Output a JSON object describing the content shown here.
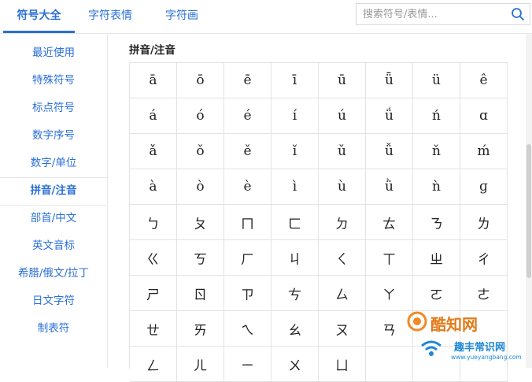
{
  "tabs": [
    {
      "label": "符号大全",
      "active": true
    },
    {
      "label": "字符表情",
      "active": false
    },
    {
      "label": "字符画",
      "active": false
    }
  ],
  "search": {
    "placeholder": "搜索符号/表情..."
  },
  "sidebar": {
    "items": [
      {
        "label": "最近使用",
        "active": false
      },
      {
        "label": "特殊符号",
        "active": false
      },
      {
        "label": "标点符号",
        "active": false
      },
      {
        "label": "数字序号",
        "active": false
      },
      {
        "label": "数字/单位",
        "active": false
      },
      {
        "label": "拼音/注音",
        "active": true
      },
      {
        "label": "部首/中文",
        "active": false
      },
      {
        "label": "英文音标",
        "active": false
      },
      {
        "label": "希腊/俄文/拉丁",
        "active": false
      },
      {
        "label": "日文字符",
        "active": false
      },
      {
        "label": "制表符",
        "active": false
      }
    ]
  },
  "main": {
    "section_title": "拼音/注音",
    "rows": [
      [
        "ā",
        "ō",
        "ē",
        "ī",
        "ū",
        "ǖ",
        "ü",
        "ê"
      ],
      [
        "á",
        "ó",
        "é",
        "í",
        "ú",
        "ǘ",
        "ń",
        "ɑ"
      ],
      [
        "ǎ",
        "ǒ",
        "ě",
        "ǐ",
        "ǔ",
        "ǚ",
        "ň",
        "ḿ"
      ],
      [
        "à",
        "ò",
        "è",
        "ì",
        "ù",
        "ǜ",
        "ǹ",
        "ɡ"
      ],
      [
        "ㄅ",
        "ㄆ",
        "ㄇ",
        "ㄈ",
        "ㄉ",
        "ㄊ",
        "ㄋ",
        "ㄌ"
      ],
      [
        "ㄍ",
        "ㄎ",
        "ㄏ",
        "ㄐ",
        "ㄑ",
        "ㄒ",
        "ㄓ",
        "ㄔ"
      ],
      [
        "ㄕ",
        "ㄖ",
        "ㄗ",
        "ㄘ",
        "ㄙ",
        "ㄚ",
        "ㄛ",
        "ㄜ"
      ],
      [
        "ㄝ",
        "ㄞ",
        "ㄟ",
        "ㄠ",
        "ㄡ",
        "ㄢ",
        "",
        ""
      ],
      [
        "ㄥ",
        "ㄦ",
        "ㄧ",
        "ㄨ",
        "ㄩ",
        "",
        "",
        ""
      ]
    ]
  },
  "watermark": {
    "brand": "酷知网",
    "site": "www.yueyangbang.com",
    "site_cn": "趣丰常识网"
  },
  "colors": {
    "accent": "#2a6fd6",
    "border": "#e3e3e3",
    "text": "#222222"
  }
}
